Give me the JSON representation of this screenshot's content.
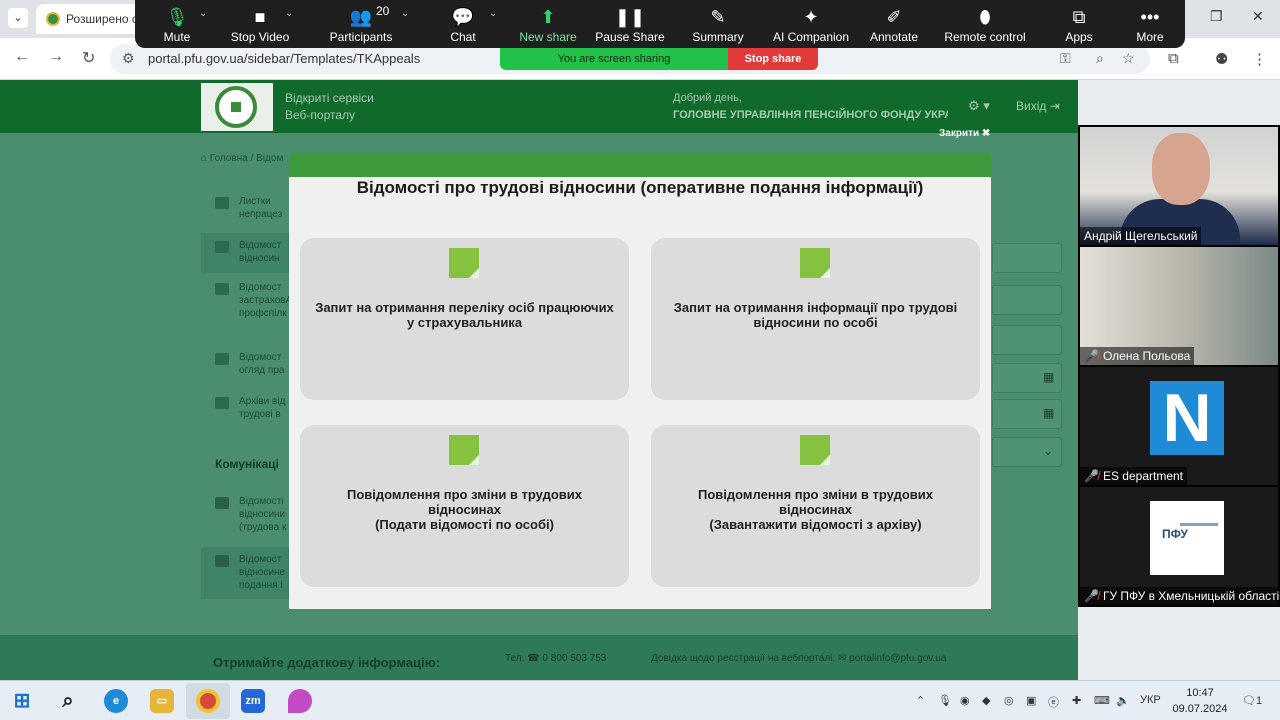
{
  "browser": {
    "tab_title": "Розширено с",
    "url": "portal.pfu.gov.ua/sidebar/Templates/TKAppeals"
  },
  "zoom": {
    "participants_count": "20",
    "items": [
      {
        "label": "Mute",
        "icon": "microphone-icon"
      },
      {
        "label": "Stop Video",
        "icon": "camera-icon"
      },
      {
        "label": "Participants",
        "icon": "participants-icon"
      },
      {
        "label": "Chat",
        "icon": "chat-icon"
      },
      {
        "label": "New share",
        "icon": "share-icon"
      },
      {
        "label": "Pause Share",
        "icon": "pause-icon"
      },
      {
        "label": "Summary",
        "icon": "summary-icon"
      },
      {
        "label": "AI Companion",
        "icon": "sparkle-icon"
      },
      {
        "label": "Annotate",
        "icon": "pen-icon"
      },
      {
        "label": "Remote control",
        "icon": "mouse-icon"
      },
      {
        "label": "Apps",
        "icon": "apps-icon"
      },
      {
        "label": "More",
        "icon": "more-icon"
      }
    ],
    "sharing_text": "You are screen sharing",
    "stop_share": "Stop share"
  },
  "portal": {
    "brand_line1": "Відкриті сервіси",
    "brand_line2": "Веб-порталу",
    "greeting": "Добрий день,",
    "org": "ГОЛОВНЕ УПРАВЛІННЯ ПЕНСІЙНОГО ФОНДУ УКРА",
    "exit": "Вихід",
    "breadcrumb": "Головна / Відом",
    "sidebar": [
      {
        "label": "Листки\nнепрацез"
      },
      {
        "label": "Відомост\nвідносин"
      },
      {
        "label": "Відомост\nзастраховA\nпрофспілк"
      },
      {
        "label": "Відомост\nогляд пра"
      },
      {
        "label": "Архіви від\nтрудові в"
      }
    ],
    "comm_heading": "Комунікаці",
    "comm_items": [
      {
        "label": "Відомості\nвідносини\n(трудова к"
      },
      {
        "label": "Відомост\nвідносине\nподання і"
      }
    ],
    "footer_title": "Отримайте додаткову інформацію:",
    "footer_phone": "Тел. ☎ 0 800 503 753",
    "footer_help": "Довідка щодо реєстрації на вебпорталі: ✉ portalinfo@pfu.gov.ua"
  },
  "modal": {
    "close_label": "Закрити ✖",
    "title": "Відомості про трудові відносини (оперативне подання інформації)",
    "cards": [
      {
        "text": "Запит на отримання переліку осіб працюючих\nу страхувальника"
      },
      {
        "text": "Запит на отримання інформації про трудові\nвідносини по особі"
      },
      {
        "text": "Повідомлення про зміни в трудових\nвідносинах\n(Подати відомості по особі)"
      },
      {
        "text": "Повідомлення про зміни в трудових\nвідносинах\n(Завантажити відомості з архіву)"
      }
    ]
  },
  "participants": [
    {
      "name": "Андрій Щегельський",
      "muted": false
    },
    {
      "name": "Олена Польова",
      "muted": true
    },
    {
      "name": "ES department",
      "muted": true
    },
    {
      "name": "ГУ ПФУ в Хмельницькій області",
      "muted": true
    }
  ],
  "taskbar": {
    "language": "УКР",
    "time": "10:47",
    "date": "09.07.2024",
    "notifications": "1"
  }
}
